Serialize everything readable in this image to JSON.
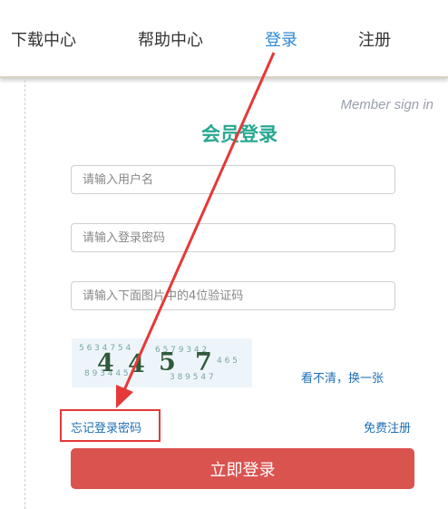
{
  "nav": {
    "items": [
      {
        "label": "下载中心"
      },
      {
        "label": "帮助中心"
      },
      {
        "label": "登录",
        "active": true
      },
      {
        "label": "注册"
      }
    ]
  },
  "form": {
    "member_sign_in": "Member sign in",
    "title": "会员登录",
    "username_placeholder": "请输入用户名",
    "password_placeholder": "请输入登录密码",
    "captcha_placeholder": "请输入下面图片中的4位验证码",
    "captcha_digits": [
      "4",
      "4",
      "5",
      "7"
    ],
    "refresh_captcha": "看不清，换一张",
    "forgot_password": "忘记登录密码",
    "free_register": "免费注册",
    "login_button": "立即登录"
  },
  "colors": {
    "accent_title": "#29a891",
    "active_nav": "#2f88d8",
    "link": "#1e6fb6",
    "login_button": "#d9534f",
    "annotation": "#e53939"
  }
}
